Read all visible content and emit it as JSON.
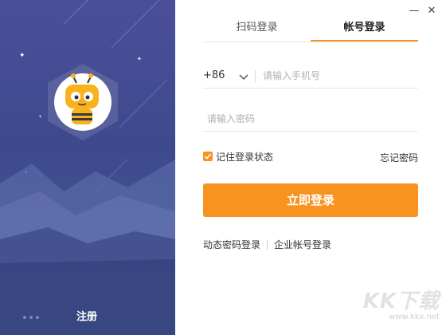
{
  "window": {
    "minimize_glyph": "—",
    "close_glyph": "✕"
  },
  "tabs": {
    "scan_login": "扫码登录",
    "account_login": "帐号登录",
    "active": "account_login"
  },
  "phone": {
    "country_code": "+86",
    "placeholder": "请输入手机号",
    "value": ""
  },
  "password": {
    "placeholder": "请输入密码",
    "value": ""
  },
  "remember": {
    "label": "记住登录状态",
    "checked": true
  },
  "forgot_password": "忘记密码",
  "login_button": "立即登录",
  "alt_login": {
    "dynamic_password": "动态密码登录",
    "enterprise": "企业帐号登录"
  },
  "register": "注册",
  "watermark": {
    "logo_text": "KK下载",
    "url": "www.kkx.net"
  },
  "colors": {
    "accent": "#f7931e",
    "left_panel": "#434c93"
  }
}
